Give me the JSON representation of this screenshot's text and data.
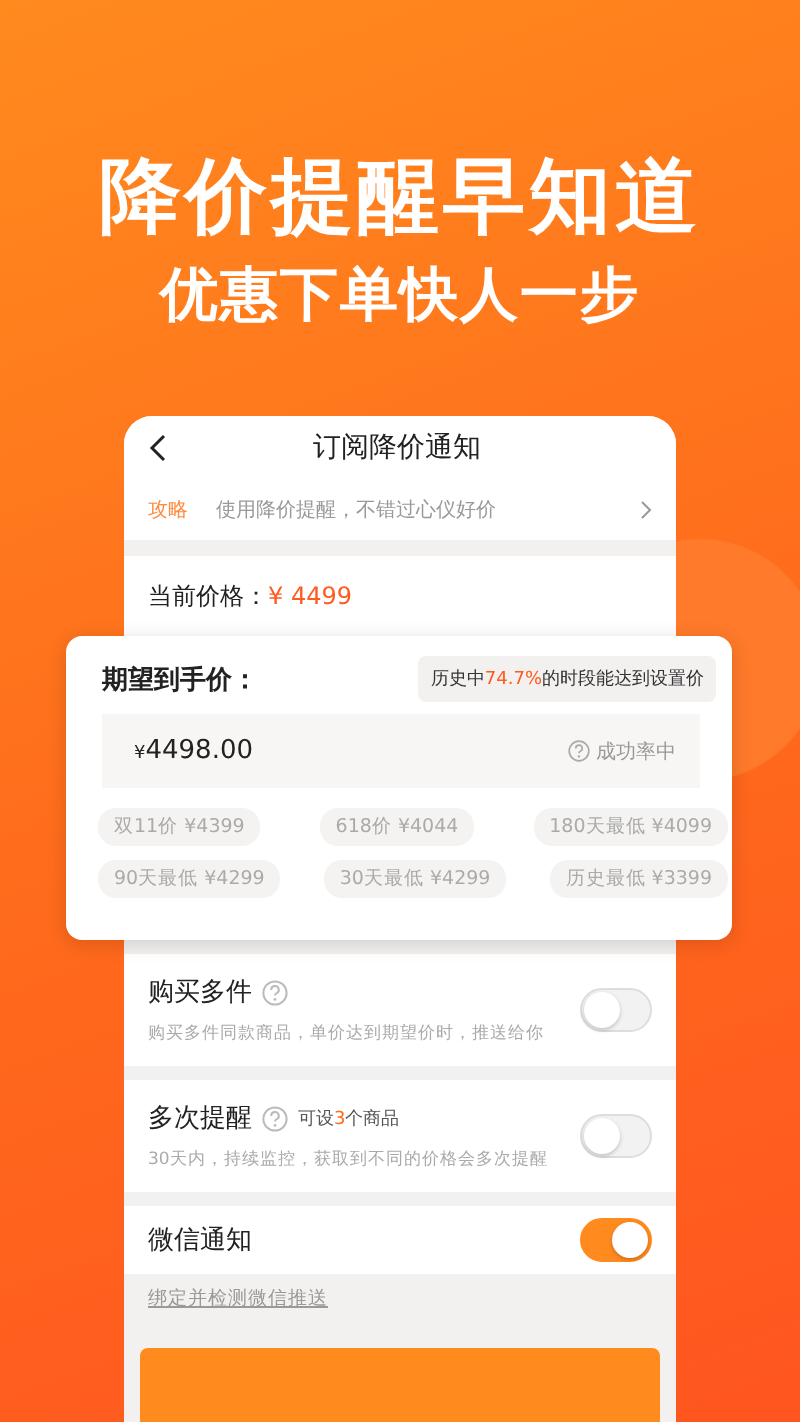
{
  "headline": "降价提醒早知道",
  "subheadline": "优惠下单快人一步",
  "screen": {
    "title": "订阅降价通知",
    "tip": {
      "tag": "攻略",
      "text": "使用降价提醒，不错过心仪好价"
    },
    "current_price": {
      "label": "当前价格：",
      "value": "¥ 4499"
    }
  },
  "popup": {
    "label": "期望到手价：",
    "hint": {
      "before": "历史中",
      "highlight": "74.7%",
      "after": "的时段能达到设置价"
    },
    "price_field": {
      "currency": "¥",
      "value": "4498.00"
    },
    "success_rate": "成功率中",
    "price_chips": [
      "双11价 ¥4399",
      "618价 ¥4044",
      "180天最低 ¥4099",
      "90天最低 ¥4299",
      "30天最低 ¥4299",
      "历史最低 ¥3399"
    ]
  },
  "settings": [
    {
      "kind": "toggle",
      "title": "购买多件",
      "help": true,
      "description": "购买多件同款商品，单价达到期望价时，推送给你",
      "on": false
    },
    {
      "kind": "toggle",
      "title": "多次提醒",
      "help": true,
      "note": {
        "before": "可设",
        "highlight": "3",
        "after": "个商品"
      },
      "description": "30天内，持续监控，获取到不同的价格会多次提醒",
      "on": false
    },
    {
      "kind": "toggle",
      "title": "微信通知",
      "help": false,
      "on": true
    }
  ],
  "link": "绑定并检测微信推送"
}
